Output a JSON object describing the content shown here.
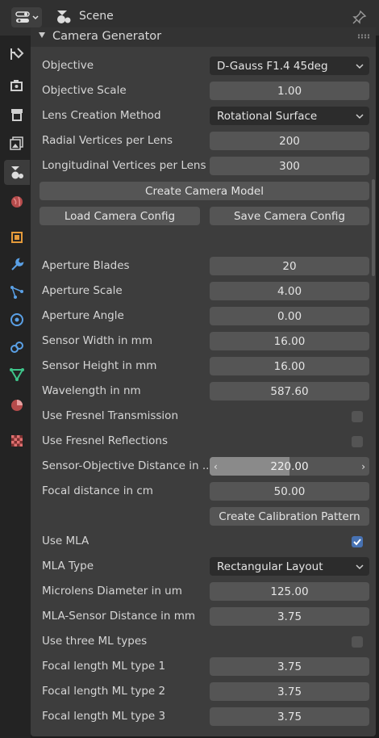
{
  "header": {
    "scene": "Scene"
  },
  "panel": {
    "title": "Camera Generator"
  },
  "sidebar": {
    "tabs": [
      "tool-icon",
      "render-icon",
      "output-icon",
      "view-layer-icon",
      "scene-icon",
      "world-icon",
      "object-icon",
      "modifier-icon",
      "particles-icon",
      "physics-icon",
      "constraints-icon",
      "data-icon",
      "material-icon",
      "texture-icon"
    ]
  },
  "props": {
    "objective": {
      "label": "Objective",
      "value": "D-Gauss F1.4 45deg"
    },
    "objective_scale": {
      "label": "Objective Scale",
      "value": "1.00"
    },
    "lens_method": {
      "label": "Lens Creation Method",
      "value": "Rotational Surface"
    },
    "radial_vertices": {
      "label": "Radial Vertices per Lens",
      "value": "200"
    },
    "long_vertices": {
      "label": "Longitudinal Vertices per Lens",
      "value": "300"
    },
    "create_model": "Create Camera Model",
    "load_config": "Load Camera Config",
    "save_config": "Save Camera Config",
    "aperture_blades": {
      "label": "Aperture Blades",
      "value": "20"
    },
    "aperture_scale": {
      "label": "Aperture Scale",
      "value": "4.00"
    },
    "aperture_angle": {
      "label": "Aperture Angle",
      "value": "0.00"
    },
    "sensor_width": {
      "label": "Sensor Width in mm",
      "value": "16.00"
    },
    "sensor_height": {
      "label": "Sensor Height in mm",
      "value": "16.00"
    },
    "wavelength": {
      "label": "Wavelength in nm",
      "value": "587.60"
    },
    "fresnel_trans": {
      "label": "Use Fresnel Transmission",
      "checked": false
    },
    "fresnel_refl": {
      "label": "Use Fresnel Reflections",
      "checked": false
    },
    "sensor_obj_dist": {
      "label": "Sensor-Objective Distance in ...",
      "value": "220.00",
      "fill": 0.5
    },
    "focal_distance": {
      "label": "Focal distance in cm",
      "value": "50.00"
    },
    "calib_pattern": "Create Calibration Pattern",
    "use_mla": {
      "label": "Use MLA",
      "checked": true
    },
    "mla_type": {
      "label": "MLA Type",
      "value": "Rectangular Layout"
    },
    "microlens_diam": {
      "label": "Microlens Diameter in um",
      "value": "125.00"
    },
    "mla_sensor_dist": {
      "label": "MLA-Sensor Distance in mm",
      "value": "3.75"
    },
    "three_ml": {
      "label": "Use three ML types",
      "checked": false
    },
    "focal_ml1": {
      "label": "Focal length ML type 1",
      "value": "3.75"
    },
    "focal_ml2": {
      "label": "Focal length ML type 2",
      "value": "3.75"
    },
    "focal_ml3": {
      "label": "Focal length ML type 3",
      "value": "3.75"
    }
  }
}
